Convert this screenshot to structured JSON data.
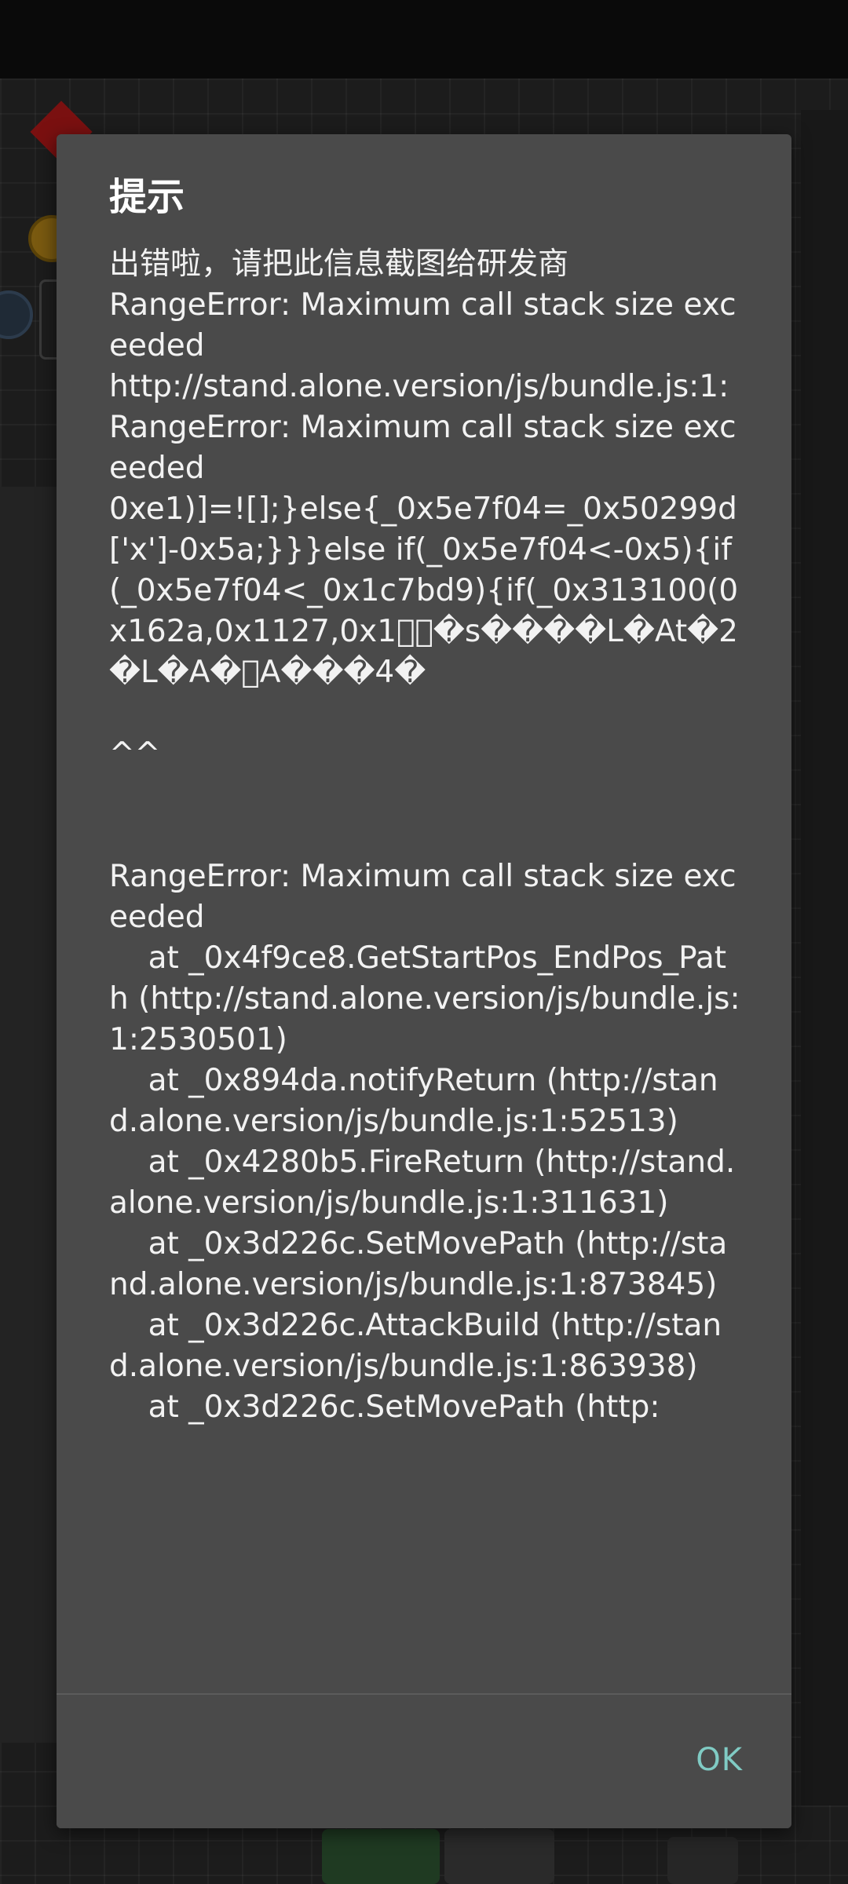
{
  "dialog": {
    "title": "提示",
    "message": "出错啦，请把此信息截图给研发商\nRangeError: Maximum call stack size exceeded\nhttp://stand.alone.version/js/bundle.js:1:\nRangeError: Maximum call stack size exceeded\n0xe1)]=![];}else{_0x5e7f04=_0x50299d['x']-0x5a;}}}else if(_0x5e7f04<-0x5){if(_0x5e7f04<_0x1c7bd9){if(_0x313100(0x162a,0x1127,0x1\u0000\u0000�s����L�At�2�L�A�\u0000A���4�\n\n^^\n\n\nRangeError: Maximum call stack size exceeded\n    at _0x4f9ce8.GetStartPos_EndPos_Path (http://stand.alone.version/js/bundle.js:1:2530501)\n    at _0x894da.notifyReturn (http://stand.alone.version/js/bundle.js:1:52513)\n    at _0x4280b5.FireReturn (http://stand.alone.version/js/bundle.js:1:311631)\n    at _0x3d226c.SetMovePath (http://stand.alone.version/js/bundle.js:1:873845)\n    at _0x3d226c.AttackBuild (http://stand.alone.version/js/bundle.js:1:863938)\n    at _0x3d226c.SetMovePath (http:",
    "ok_label": "OK"
  }
}
